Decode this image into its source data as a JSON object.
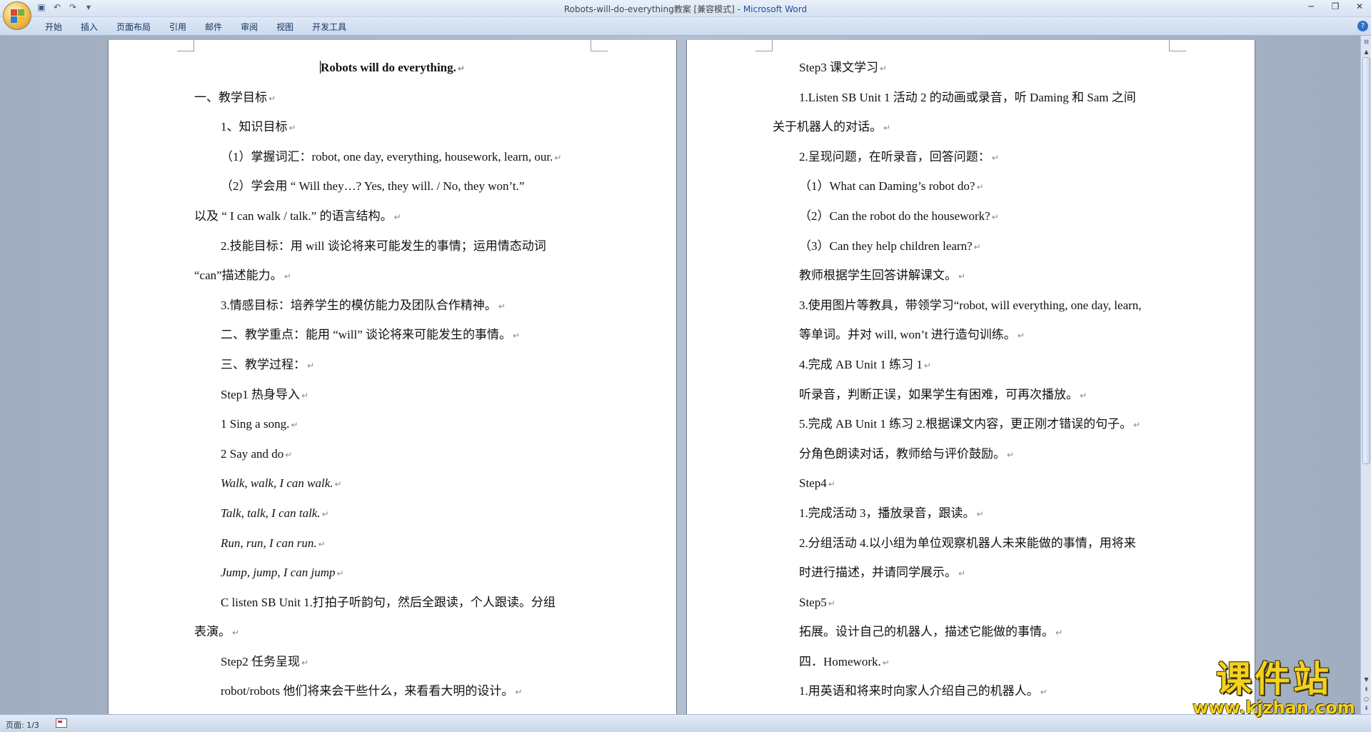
{
  "window": {
    "title": "Robots-will-do-everything教案 [兼容模式] - ",
    "app_name": "Microsoft Word"
  },
  "quick_access": [
    "save-icon",
    "undo-icon",
    "redo-icon",
    "customize-icon"
  ],
  "ribbon": {
    "tabs": [
      "开始",
      "插入",
      "页面布局",
      "引用",
      "邮件",
      "审阅",
      "视图",
      "开发工具"
    ]
  },
  "left_page": {
    "title": "Robots will do everything.",
    "lines": [
      "一、教学目标",
      "1、知识目标",
      "（1）掌握词汇：robot, one day, everything, housework, learn, our.",
      "（2）学会用 “ Will they…? Yes, they will. / No, they won’t.”",
      "以及 “ I can walk / talk.” 的语言结构。",
      "2.技能目标：用 will 谈论将来可能发生的事情；运用情态动词",
      "“can”描述能力。",
      "3.情感目标：培养学生的模仿能力及团队合作精神。",
      "二、教学重点：能用 “will” 谈论将来可能发生的事情。",
      "三、教学过程：",
      "Step1 热身导入",
      "1 Sing a song.",
      "2 Say and do",
      "Walk, walk, I can walk.",
      "Talk, talk, I can talk.",
      "Run, run, I can run.",
      "Jump, jump, I can jump",
      "C listen SB Unit 1.打拍子听韵句，然后全跟读，个人跟读。分组",
      "表演。",
      "Step2 任务呈现",
      "robot/robots 他们将来会干些什么，来看看大明的设计。"
    ]
  },
  "right_page": {
    "lines": [
      "Step3 课文学习",
      "1.Listen SB Unit 1 活动 2 的动画或录音，听 Daming 和 Sam 之间",
      "关于机器人的对话。",
      "2.呈现问题，在听录音，回答问题：",
      "（1）What can Daming’s robot do?",
      "（2）Can the robot do the housework?",
      "（3）Can they help children learn?",
      "教师根据学生回答讲解课文。",
      "3.使用图片等教具，带领学习“robot, will everything, one day, learn,",
      "等单词。并对 will, won’t 进行造句训练。",
      "4.完成 AB Unit 1 练习 1",
      "听录音，判断正误，如果学生有困难，可再次播放。",
      "5.完成 AB Unit 1 练习 2.根据课文内容，更正刚才错误的句子。",
      "分角色朗读对话，教师给与评价鼓励。",
      "Step4",
      "1.完成活动 3，播放录音，跟读。",
      "2.分组活动 4.以小组为单位观察机器人未来能做的事情，用将来",
      "时进行描述，并请同学展示。",
      "Step5",
      "拓展。设计自己的机器人，描述它能做的事情。",
      "四．Homework.",
      "1.用英语和将来时向家人介绍自己的机器人。"
    ]
  },
  "status_bar": {
    "page_info": "页面: 1/3"
  },
  "watermark": {
    "main": "课件站",
    "sub": "www.kjzhan.com"
  }
}
